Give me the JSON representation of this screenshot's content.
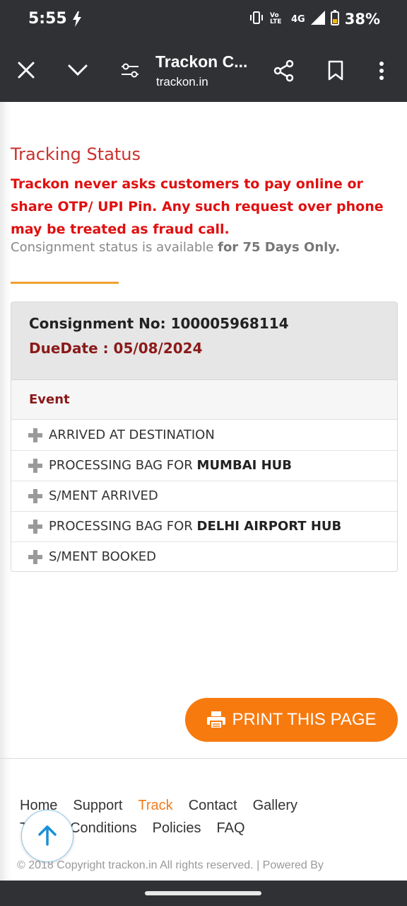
{
  "status_bar": {
    "time": "5:55",
    "battery": "38%",
    "network": "4G",
    "volte": "Vo LTE",
    "icons": [
      "flash-icon",
      "vibrate-icon",
      "signal-icon",
      "battery-icon"
    ]
  },
  "toolbar": {
    "title": "Trackon C...",
    "url": "trackon.in",
    "icons": [
      "close-icon",
      "chevron-down-icon",
      "settings-sliders-icon",
      "share-icon",
      "bookmark-icon",
      "more-icon"
    ]
  },
  "page": {
    "heading": "Tracking Status",
    "warning": "Trackon never asks customers to pay online or share OTP/ UPI Pin. Any such request over phone may be treated as fraud call.",
    "availability_prefix": "Consignment status is available ",
    "availability_bold": "for 75 Days Only."
  },
  "consignment": {
    "number_label": "Consignment No: 100005968114",
    "due_date_label": "DueDate : 05/08/2024",
    "event_header": "Event",
    "events": [
      {
        "text": "ARRIVED AT DESTINATION",
        "bold": ""
      },
      {
        "text": "PROCESSING BAG FOR ",
        "bold": "MUMBAI HUB"
      },
      {
        "text": "S/MENT ARRIVED",
        "bold": ""
      },
      {
        "text": "PROCESSING BAG FOR ",
        "bold": "DELHI AIRPORT HUB"
      },
      {
        "text": "S/MENT BOOKED",
        "bold": ""
      }
    ]
  },
  "print_button": {
    "label": "PRINT THIS PAGE"
  },
  "footer": {
    "links_row1": [
      "Home",
      "Support",
      "Track",
      "Contact",
      "Gallery"
    ],
    "links_row2": [
      "T",
      "& Conditions",
      "Policies",
      "FAQ"
    ],
    "active_link": "Track",
    "copyright": "© 2018 Copyright trackon.in All rights reserved.   |   Powered By"
  },
  "colors": {
    "accent_orange": "#f77a0f",
    "heading_red": "#c9302c",
    "warning_red": "#e01010",
    "due_dark_red": "#8b1a1a",
    "chrome_dark": "#303135"
  }
}
